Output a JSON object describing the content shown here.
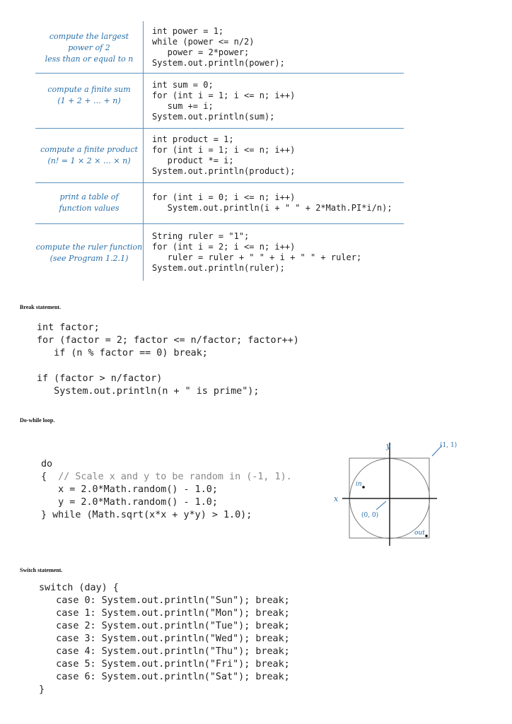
{
  "table": {
    "rows": [
      {
        "desc": [
          "compute the largest",
          "power of 2",
          "less than or equal to n"
        ],
        "code": "int power = 1;\nwhile (power <= n/2)\n   power = 2*power;\nSystem.out.println(power);"
      },
      {
        "desc": [
          "compute a finite sum",
          "(1 + 2 + … + n)"
        ],
        "code": "int sum = 0;\nfor (int i = 1; i <= n; i++)\n   sum += i;\nSystem.out.println(sum);"
      },
      {
        "desc": [
          "compute a finite product",
          "(n! = 1 × 2 ×  …  × n)"
        ],
        "code": "int product = 1;\nfor (int i = 1; i <= n; i++)\n   product *= i;\nSystem.out.println(product);"
      },
      {
        "desc": [
          "print a table of",
          "function values"
        ],
        "code": "for (int i = 0; i <= n; i++)\n   System.out.println(i + \" \" + 2*Math.PI*i/n);"
      },
      {
        "desc": [
          "compute the ruler function",
          "(see Program 1.2.1)"
        ],
        "code": "String ruler = \"1\";\nfor (int i = 2; i <= n; i++)\n   ruler = ruler + \" \" + i + \" \" + ruler;\nSystem.out.println(ruler);"
      }
    ]
  },
  "break_section": {
    "heading": "Break statement.",
    "code": "int factor;\nfor (factor = 2; factor <= n/factor; factor++)\n   if (n % factor == 0) break;\n\nif (factor > n/factor)\n   System.out.println(n + \" is prime\");"
  },
  "dowhile_section": {
    "heading": "Do-while loop.",
    "line1": "do",
    "line2_brace": "{  ",
    "line2_comment": "// Scale x and y to be random in (-1, 1).",
    "code_rest": "   x = 2.0*Math.random() - 1.0;\n   y = 2.0*Math.random() - 1.0;\n} while (Math.sqrt(x*x + y*y) > 1.0);",
    "diagram": {
      "y_label": "y",
      "x_label": "x",
      "corner_label": "(1, 1)",
      "origin_label": "(0, 0)",
      "in_label": "in",
      "out_label": "out",
      "label_color": "#2a6fa8"
    }
  },
  "switch_section": {
    "heading": "Switch statement.",
    "code": "switch (day) {\n   case 0: System.out.println(\"Sun\"); break;\n   case 1: System.out.println(\"Mon\"); break;\n   case 2: System.out.println(\"Tue\"); break;\n   case 3: System.out.println(\"Wed\"); break;\n   case 4: System.out.println(\"Thu\"); break;\n   case 5: System.out.println(\"Fri\"); break;\n   case 6: System.out.println(\"Sat\"); break;\n}"
  }
}
